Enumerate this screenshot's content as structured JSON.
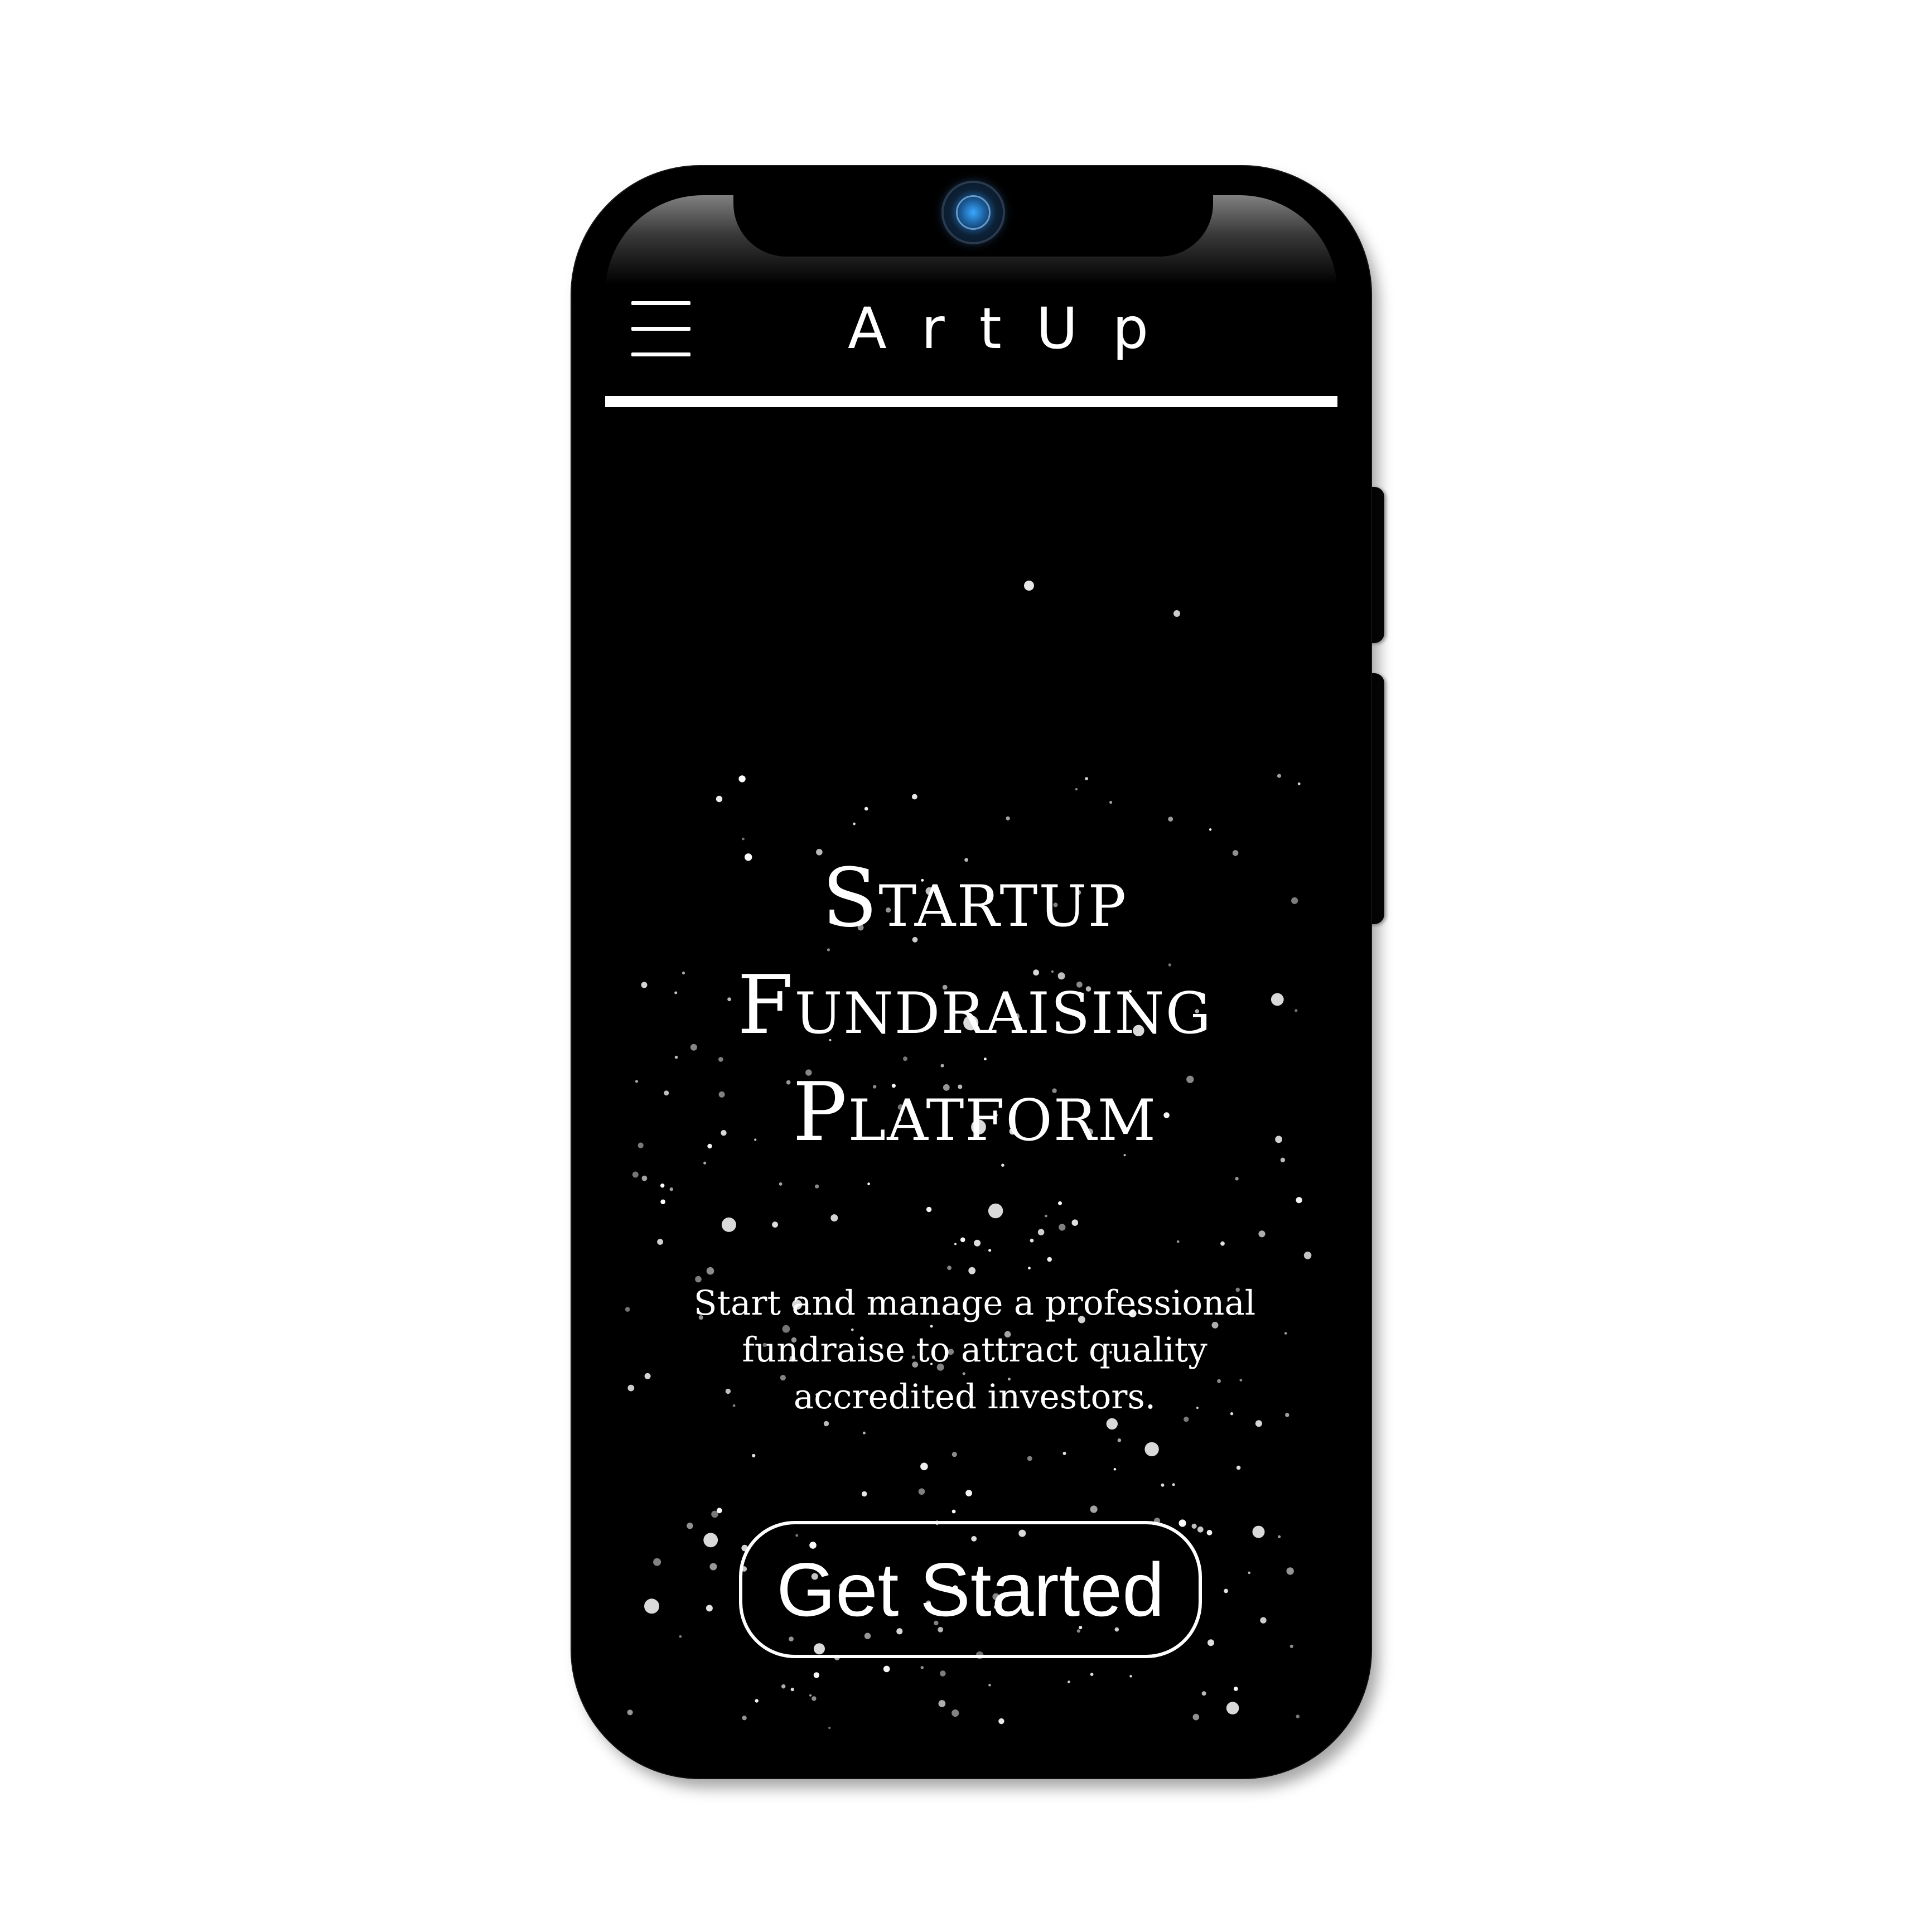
{
  "app": {
    "brand": "ArtUp"
  },
  "hero": {
    "title_lines": [
      "Startup",
      "Fundraising",
      "Platform"
    ],
    "subtitle_lines": [
      "Start and manage a professional",
      "fundraise to attract quality",
      "accredited investors."
    ],
    "cta_label": "Get Started"
  },
  "theme": {
    "background": "#000000",
    "foreground": "#ffffff",
    "camera_accent": "#3aa8ff"
  },
  "icons": {
    "menu": "hamburger-menu-icon",
    "camera": "front-camera-icon"
  }
}
